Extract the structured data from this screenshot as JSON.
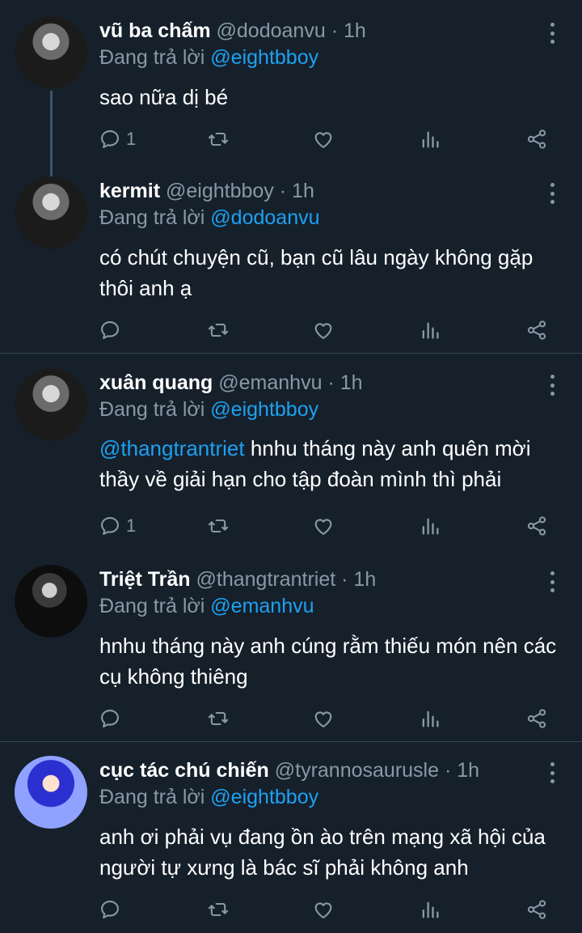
{
  "tweets": [
    {
      "name": "vũ ba chấm",
      "handle": "@dodoanvu",
      "time": "· 1h",
      "reply_prefix": "Đang trả lời",
      "reply_to": "@eightbboy",
      "text_mention": "",
      "text": "sao nữa dị bé",
      "reply_count": "1"
    },
    {
      "name": "kermit",
      "handle": "@eightbboy",
      "time": "· 1h",
      "reply_prefix": "Đang trả lời",
      "reply_to": "@dodoanvu",
      "text_mention": "",
      "text": "có chút chuyện cũ, bạn cũ lâu ngày không gặp thôi anh ạ",
      "reply_count": ""
    },
    {
      "name": "xuân quang",
      "handle": "@emanhvu",
      "time": "· 1h",
      "reply_prefix": "Đang trả lời",
      "reply_to": "@eightbboy",
      "text_mention": "@thangtrantriet",
      "text": "hnhu tháng này anh quên mời thầy về giải hạn cho tập đoàn mình thì phải",
      "reply_count": "1"
    },
    {
      "name": "Triệt Trần",
      "handle": "@thangtrantriet",
      "time": "· 1h",
      "reply_prefix": "Đang trả lời",
      "reply_to": "@emanhvu",
      "text_mention": "",
      "text": "hnhu tháng này anh cúng rằm thiếu món nên các cụ không thiêng",
      "reply_count": ""
    },
    {
      "name": "cục tác chú chiến",
      "handle": "@tyrannosaurusle",
      "time": "· 1h",
      "reply_prefix": "Đang trả lời",
      "reply_to": "@eightbboy",
      "text_mention": "",
      "text": "anh ơi phải vụ đang ồn ào trên mạng xã hội của người tự xưng là bác sĩ phải không anh",
      "reply_count": ""
    }
  ],
  "icons": {
    "reply": "reply-icon",
    "retweet": "retweet-icon",
    "like": "like-icon",
    "stats": "stats-icon",
    "share": "share-icon",
    "more": "more-icon"
  },
  "colors": {
    "background": "#15202b",
    "text": "#ffffff",
    "muted": "#8899a6",
    "accent": "#1da1f2",
    "divider": "#38444d"
  }
}
